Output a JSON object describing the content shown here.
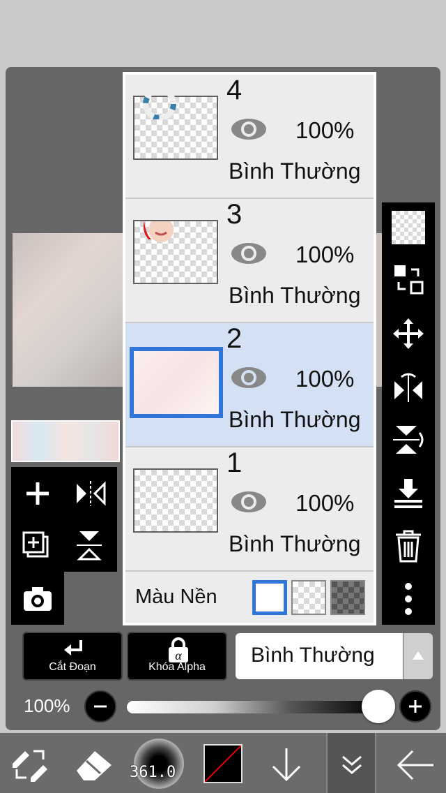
{
  "layers": [
    {
      "number": "4",
      "opacity": "100%",
      "blend": "Bình Thường",
      "selected": false
    },
    {
      "number": "3",
      "opacity": "100%",
      "blend": "Bình Thường",
      "selected": false
    },
    {
      "number": "2",
      "opacity": "100%",
      "blend": "Bình Thường",
      "selected": true
    },
    {
      "number": "1",
      "opacity": "100%",
      "blend": "Bình Thường",
      "selected": false
    }
  ],
  "background": {
    "label": "Màu Nền"
  },
  "bottom_controls": {
    "clipping_label": "Cắt Đoạn",
    "alpha_lock_label": "Khóa Alpha",
    "blend_mode_value": "Bình Thường"
  },
  "opacity_slider": {
    "label": "100%",
    "value": 1.0
  },
  "bottom_bar": {
    "brush_size": "361.0"
  },
  "icons": {
    "right_toolbar": [
      "checkerboard-icon",
      "reference-swap-icon",
      "move-icon",
      "flip-horizontal-icon",
      "flip-vertical-icon",
      "merge-down-icon",
      "trash-icon",
      "more-icon"
    ],
    "left_toolbar": [
      "add-layer-icon",
      "flip-horizontal-icon",
      "duplicate-layer-icon",
      "flip-vertical-icon",
      "camera-icon"
    ],
    "bottom_bar": [
      "transform-tool-icon",
      "eraser-icon",
      "brush-icon",
      "color-swatch",
      "arrow-down-icon",
      "chevron-double-down-icon",
      "back-arrow-icon"
    ]
  },
  "colors": {
    "selection": "#2f76d8",
    "selected_row": "#d4e0f4",
    "toolbar": "#000000"
  }
}
